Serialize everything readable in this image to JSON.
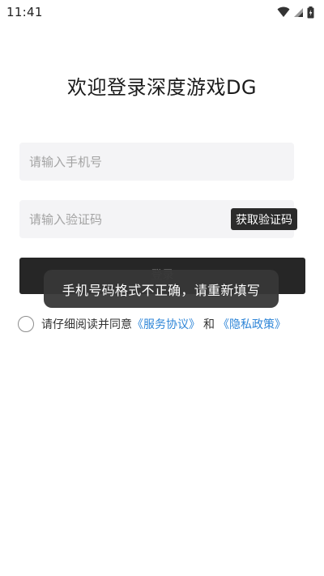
{
  "status_bar": {
    "time": "11:41",
    "icons": [
      "wifi-icon",
      "signal-icon",
      "battery-icon"
    ]
  },
  "title": "欢迎登录深度游戏DG",
  "phone": {
    "placeholder": "请输入手机号",
    "value": ""
  },
  "code": {
    "placeholder": "请输入验证码",
    "value": "",
    "get_code_label": "获取验证码"
  },
  "login_label": "登录",
  "toast": "手机号码格式不正确，请重新填写",
  "agreement": {
    "checked": false,
    "prefix": "请仔细阅读并同意",
    "service_link": "《服务协议》",
    "and": "和",
    "privacy_link": "《隐私政策》"
  },
  "colors": {
    "link": "#2f86d8",
    "button_dark": "#262626",
    "field_bg": "#f4f4f6"
  }
}
